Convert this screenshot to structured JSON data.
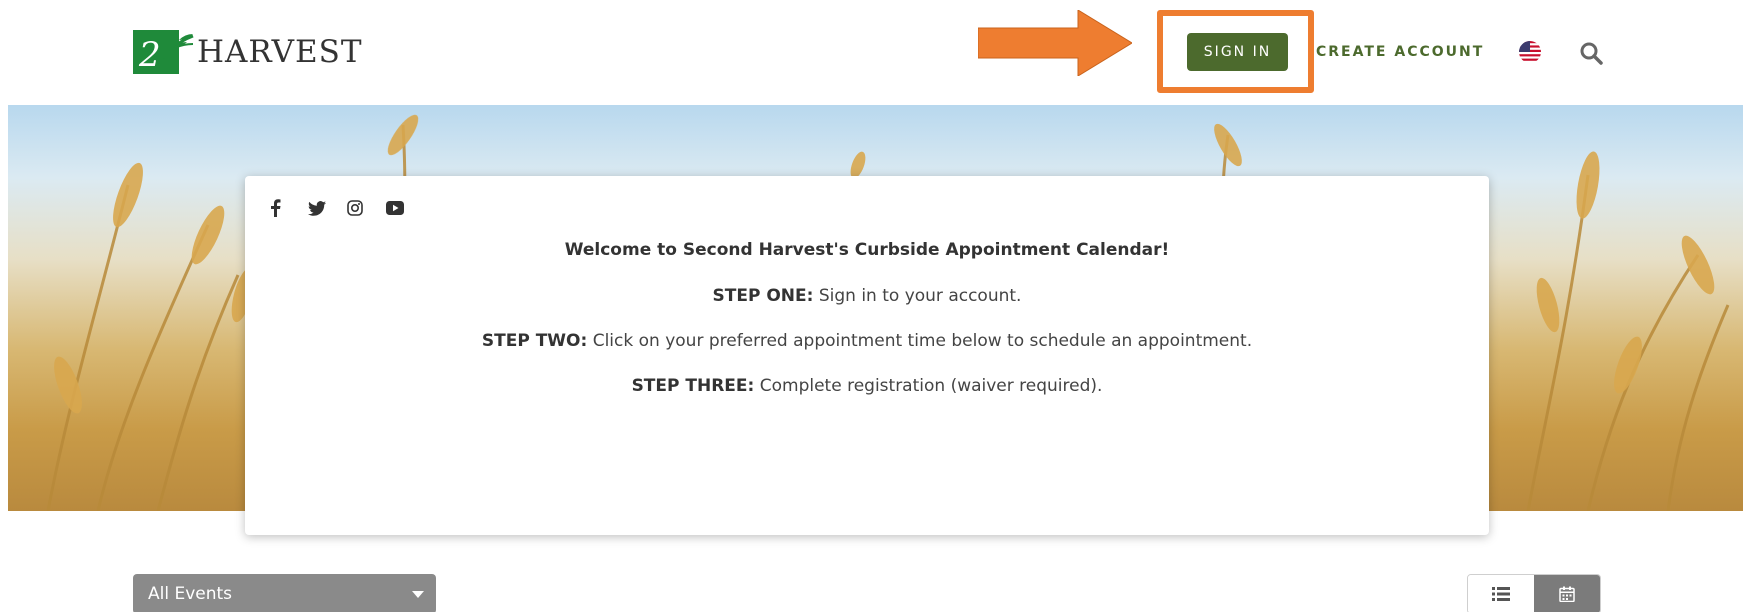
{
  "header": {
    "logo_text": "HARVEST",
    "logo_mark": "2nd",
    "signin_label": "SIGN IN",
    "create_account_label": "CREATE ACCOUNT",
    "icons": [
      "us-flag-icon",
      "search-icon"
    ]
  },
  "annotation": {
    "arrow_color": "#ee7d30",
    "box_color": "#ee7d30"
  },
  "social": [
    "facebook-icon",
    "twitter-icon",
    "instagram-icon",
    "youtube-icon"
  ],
  "card": {
    "welcome": "Welcome to Second Harvest's Curbside Appointment Calendar!",
    "step_one_label": "STEP ONE:",
    "step_one_text": " Sign in to your account.",
    "step_two_label": "STEP TWO:",
    "step_two_text": " Click on your preferred appointment time below to schedule an appointment.",
    "step_three_label": "STEP THREE:",
    "step_three_text": " Complete registration (waiver required)."
  },
  "filter": {
    "selected": "All Events"
  },
  "view_toggle": {
    "options": [
      "list-view-icon",
      "calendar-view-icon"
    ],
    "active": "calendar-view-icon"
  },
  "colors": {
    "brand_green": "#4c6a2d",
    "accent_orange": "#ee7d30",
    "filter_gray": "#8a8a8a"
  }
}
